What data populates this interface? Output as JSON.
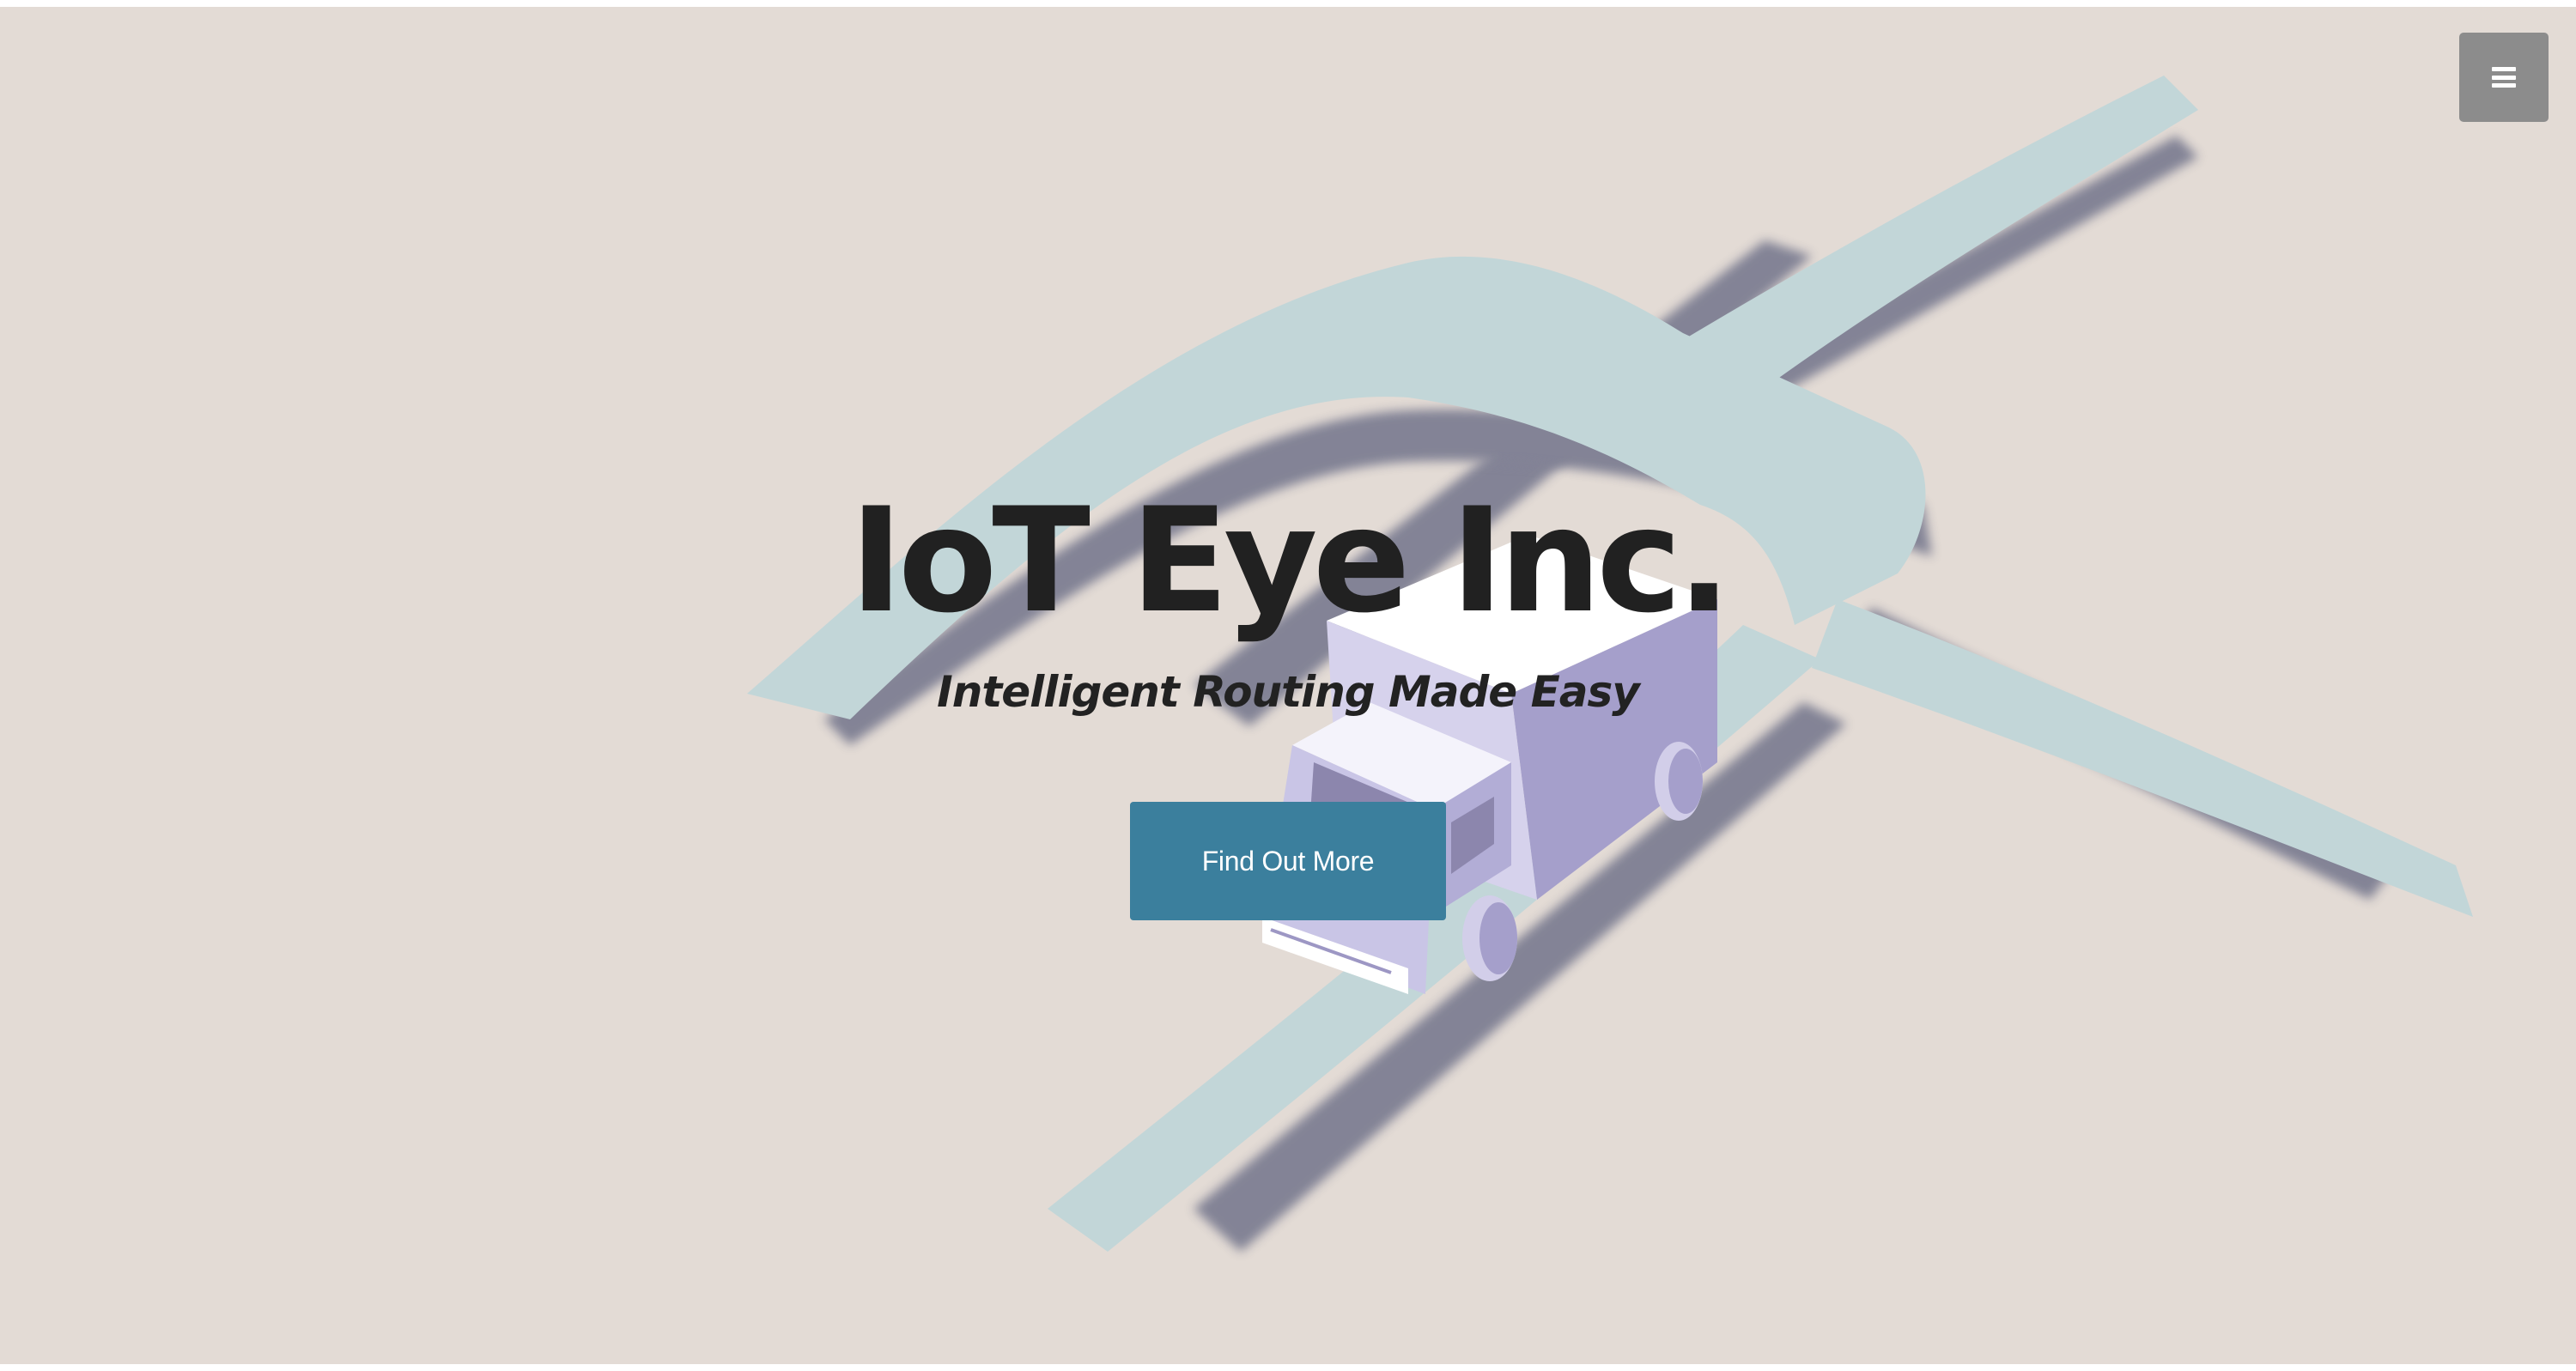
{
  "hero": {
    "title": "IoT Eye Inc.",
    "subtitle": "Intelligent Routing Made Easy",
    "cta_label": "Find Out More"
  },
  "navigation": {
    "menu_icon": "hamburger-menu-icon"
  },
  "illustration": {
    "subject": "delivery-truck-on-road-intersection",
    "road_color": "#c2d6d8",
    "road_shadow_color": "#7e7f93",
    "truck_color": "#c9c5e6"
  },
  "colors": {
    "background": "#e3dbd5",
    "accent": "#3b7f9d",
    "menu_button": "#8c8c8c",
    "text": "#212121"
  }
}
